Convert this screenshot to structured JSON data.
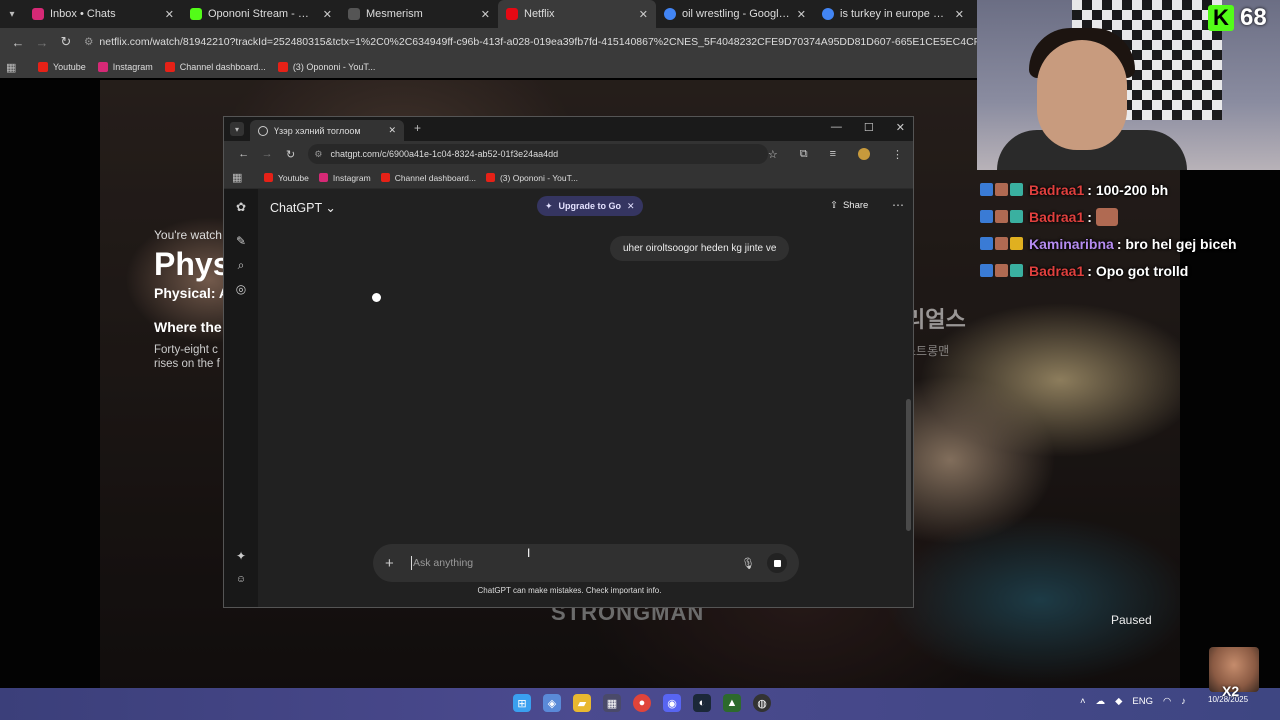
{
  "outer_browser": {
    "tabs": [
      {
        "title": "Inbox • Chats",
        "color": "#d62976"
      },
      {
        "title": "Opononi Stream - Watch Live o",
        "color": "#53fc18"
      },
      {
        "title": "Mesmerism",
        "color": "#888888"
      },
      {
        "title": "Netflix",
        "color": "#e50914",
        "active": true
      },
      {
        "title": "oil wrestling - Google Хайлт",
        "color": "#4285f4"
      },
      {
        "title": "is turkey in europe or asia - Go",
        "color": "#4285f4"
      }
    ],
    "url": "netflix.com/watch/81942210?trackId=252480315&tctx=1%2C0%2C634949ff-c96b-413f-a028-019ea39fb7fd-415140867%2CNES_5F4048232CFE9D70374A95DD81D607-665E1CE5EC4CF1-93B015101F_p_1761646639",
    "bookmarks": [
      "Youtube",
      "Instagram",
      "Channel dashboard...",
      "(3) Opononi - YouT..."
    ]
  },
  "netflix": {
    "watching": "You're watch",
    "title": "Phys",
    "subtitle": "Physical: A",
    "episode": "Where the",
    "desc_line1": "Forty-eight c",
    "desc_line2": "rises on the f",
    "korean_line1": "리얼스",
    "korean_line2": "스트롱맨",
    "strongman": "STRONGMAN",
    "paused": "Paused"
  },
  "kick": {
    "logo": "K",
    "viewers": "68"
  },
  "chat": [
    {
      "name": "Badraa1",
      "name_color": "red",
      "message": ": 100-200 bh"
    },
    {
      "name": "Badraa1",
      "name_color": "red",
      "message": ":",
      "emote": true
    },
    {
      "name": "Kaminaribna",
      "name_color": "purple",
      "message": ": bro hel gej biceh"
    },
    {
      "name": "Badraa1",
      "name_color": "red",
      "message": ": Opo got trolld"
    }
  ],
  "inner_browser": {
    "tab_title": "Үзэр хэлний тоглоом",
    "url": "chatgpt.com/c/6900a41e-1c04-8324-ab52-01f3e24aa4dd",
    "bookmarks": [
      "Youtube",
      "Instagram",
      "Channel dashboard...",
      "(3) Opononi - YouT..."
    ]
  },
  "chatgpt": {
    "model": "ChatGPT",
    "upgrade": "Upgrade to Go",
    "share": "Share",
    "user_message": "uher oiroltsoogor heden kg jinte ve",
    "placeholder": "Ask anything",
    "disclaimer": "ChatGPT can make mistakes. Check important info."
  },
  "taskbar": {
    "lang": "ENG",
    "date": "10/28/2025"
  },
  "emote_overlay": "X2"
}
